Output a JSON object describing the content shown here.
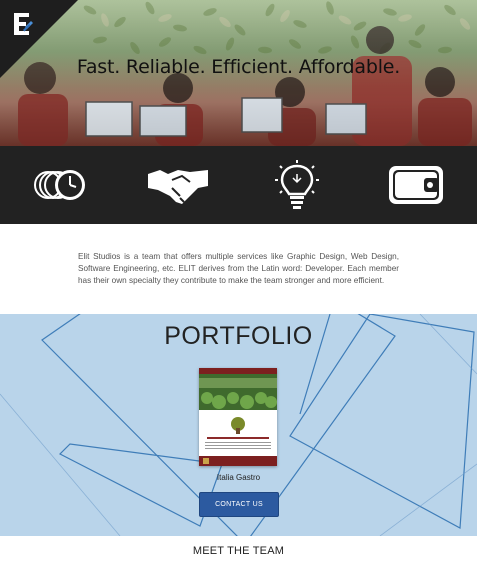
{
  "hero": {
    "title": "Fast. Reliable. Efficient. Affordable."
  },
  "band": {
    "icons": [
      "clock-stack-icon",
      "handshake-icon",
      "lightbulb-icon",
      "wallet-icon"
    ]
  },
  "about": {
    "text": "Elit Studios is a team that offers multiple services like Graphic Design, Web Design, Software Engineering, etc. ELIT derives from the Latin word: Developer. Each member has their own specialty they contribute to make the team stronger and more efficient."
  },
  "portfolio": {
    "title": "PORTFOLIO",
    "item_caption": "Italia Gastro",
    "contact_label": "CONTACT US"
  },
  "meet": {
    "title": "MEET THE TEAM"
  },
  "colors": {
    "band_bg": "#222222",
    "portfolio_bg": "#b9d4ea",
    "button_bg": "#2c5aa0"
  }
}
